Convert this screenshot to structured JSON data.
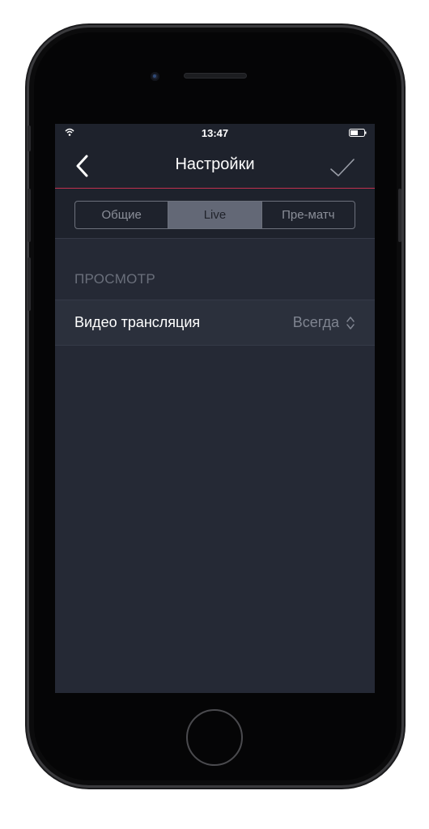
{
  "status_bar": {
    "time": "13:47",
    "wifi_icon": "wifi-icon",
    "battery_icon": "battery-icon"
  },
  "nav": {
    "title": "Настройки",
    "back_icon": "chevron-left-icon",
    "confirm_icon": "checkmark-icon"
  },
  "tabs": [
    {
      "label": "Общие",
      "active": false
    },
    {
      "label": "Live",
      "active": true
    },
    {
      "label": "Пре-матч",
      "active": false
    }
  ],
  "section": {
    "header": "ПРОСМОТР",
    "rows": [
      {
        "label": "Видео трансляция",
        "value": "Всегда",
        "icon": "updown-chevron-icon"
      }
    ]
  },
  "colors": {
    "accent_line": "#c2314f",
    "background": "#252935",
    "bar_background": "#1e222c"
  }
}
